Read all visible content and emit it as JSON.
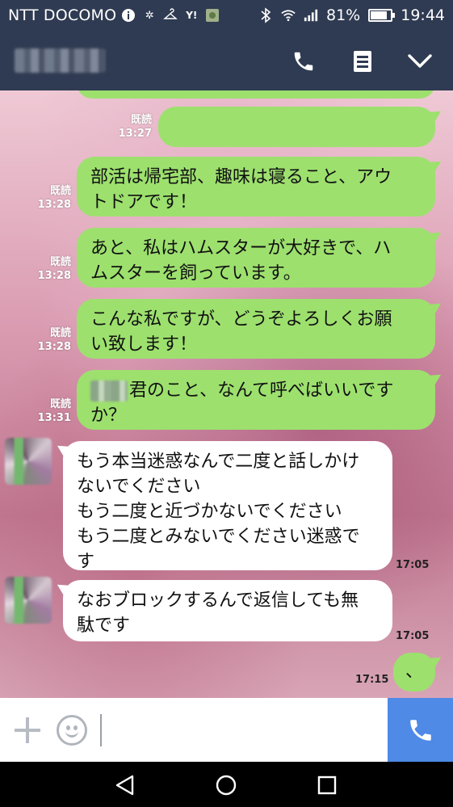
{
  "status_bar": {
    "carrier": "NTT DOCOMO",
    "battery": "81%",
    "battery_level": 0.81,
    "time": "19:44",
    "icons": [
      "info-icon",
      "snowflake-icon",
      "hanger-icon",
      "yahoo-icon",
      "app-icon",
      "bluetooth-icon",
      "wifi-icon",
      "signal-icon",
      "battery-icon"
    ]
  },
  "header": {
    "icons": [
      "phone-icon",
      "notes-icon",
      "chevron-down-icon"
    ]
  },
  "messages": [
    {
      "side": "out",
      "text": "",
      "blurred": true,
      "read": "既読",
      "time": "13:27"
    },
    {
      "side": "out",
      "text": "部活は帰宅部、趣味は寝ること、アウ\nトドアです！",
      "read": "既読",
      "time": "13:28"
    },
    {
      "side": "out",
      "text": "あと、私はハムスターが大好きで、ハ\nムスターを飼っています。",
      "read": "既読",
      "time": "13:28"
    },
    {
      "side": "out",
      "text": "こんな私ですが、どうぞよろしくお願\nい致します！",
      "read": "既読",
      "time": "13:28"
    },
    {
      "side": "out",
      "text": "君のこと、なんて呼べばいいです\nか？",
      "prefix_blurred": true,
      "read": "既読",
      "time": "13:31"
    },
    {
      "side": "in",
      "text": "もう本当迷惑なんで二度と話しかけ\nないでください\nもう二度と近づかないでください\nもう二度とみないでください迷惑で\nす",
      "time": "17:05"
    },
    {
      "side": "in",
      "text": "なおブロックするんで返信しても無\n駄です",
      "time": "17:05"
    },
    {
      "side": "out",
      "text": "、",
      "time": "17:15"
    }
  ],
  "input_bar": {
    "placeholder": ""
  },
  "colors": {
    "header_bg": "#2f3b52",
    "outgoing_bubble": "#9de06e",
    "incoming_bubble": "#ffffff",
    "call_button": "#4e8ae6"
  }
}
